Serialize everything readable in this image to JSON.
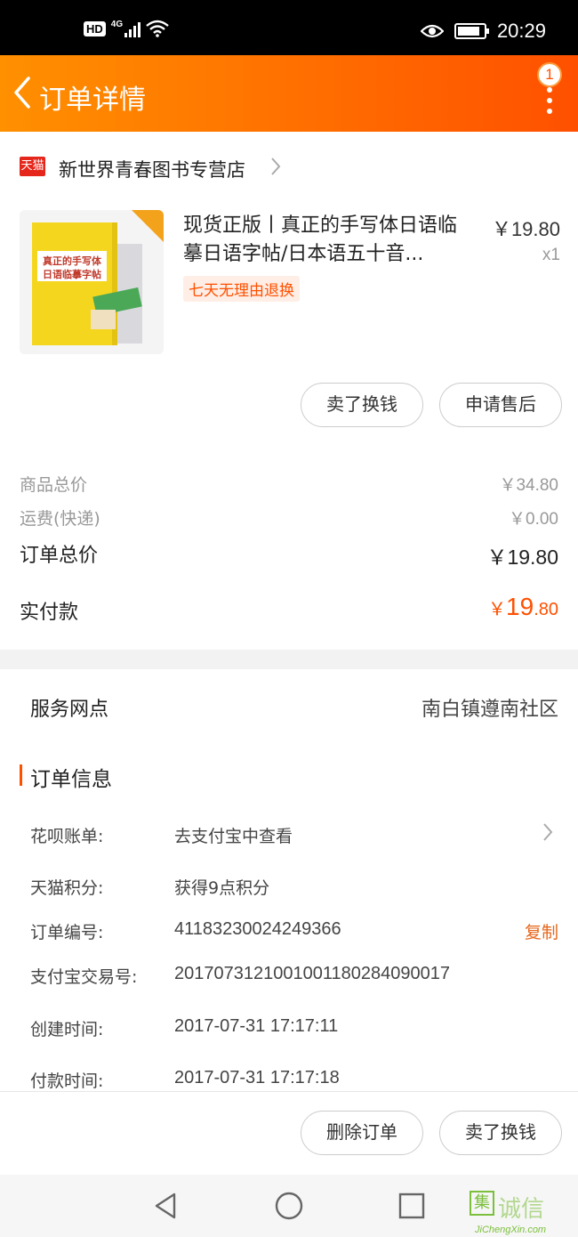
{
  "status_bar": {
    "hd": "HD",
    "network": "4G",
    "time": "20:29",
    "battery_level": 0.85
  },
  "header": {
    "title": "订单详情",
    "notification_count": "1",
    "accent_color": "#ff6a00"
  },
  "store": {
    "badge": "天猫",
    "name": "新世界青春图书专营店"
  },
  "product": {
    "name_line1": "现货正版丨真正的手写体日语临",
    "name_line2": "摹日语字帖/日本语五十音...",
    "price": "￥19.80",
    "quantity": "x1",
    "tag": "七天无理由退换",
    "cover_title": "真正的手写体",
    "cover_subtitle": "日语临摹字帖"
  },
  "product_actions": {
    "sell": "卖了换钱",
    "after_sale": "申请售后"
  },
  "summary": {
    "goods_total_label": "商品总价",
    "goods_total_value": "￥34.80",
    "shipping_label": "运费(快递)",
    "shipping_value": "￥0.00",
    "order_total_label": "订单总价",
    "order_total_value": "￥19.80",
    "paid_label": "实付款",
    "paid_currency": "￥",
    "paid_integer": "19",
    "paid_decimal": ".80"
  },
  "service": {
    "label": "服务网点",
    "value": "南白镇遵南社区"
  },
  "order_info": {
    "title": "订单信息",
    "huabei_label": "花呗账单:",
    "huabei_value": "去支付宝中查看",
    "points_label": "天猫积分:",
    "points_value": "获得9点积分",
    "order_no_label": "订单编号:",
    "order_no_value": "41183230024249366",
    "copy": "复制",
    "alipay_no_label": "支付宝交易号:",
    "alipay_no_value": "2017073121001001180284090017",
    "created_label": "创建时间:",
    "created_value": "2017-07-31 17:17:11",
    "paid_time_label": "付款时间:",
    "paid_time_value": "2017-07-31 17:17:18"
  },
  "bottom_actions": {
    "delete": "删除订单",
    "sell": "卖了换钱"
  },
  "watermark": {
    "glyph": "集",
    "text": "诚信",
    "domain": "JiChengXin.com"
  }
}
